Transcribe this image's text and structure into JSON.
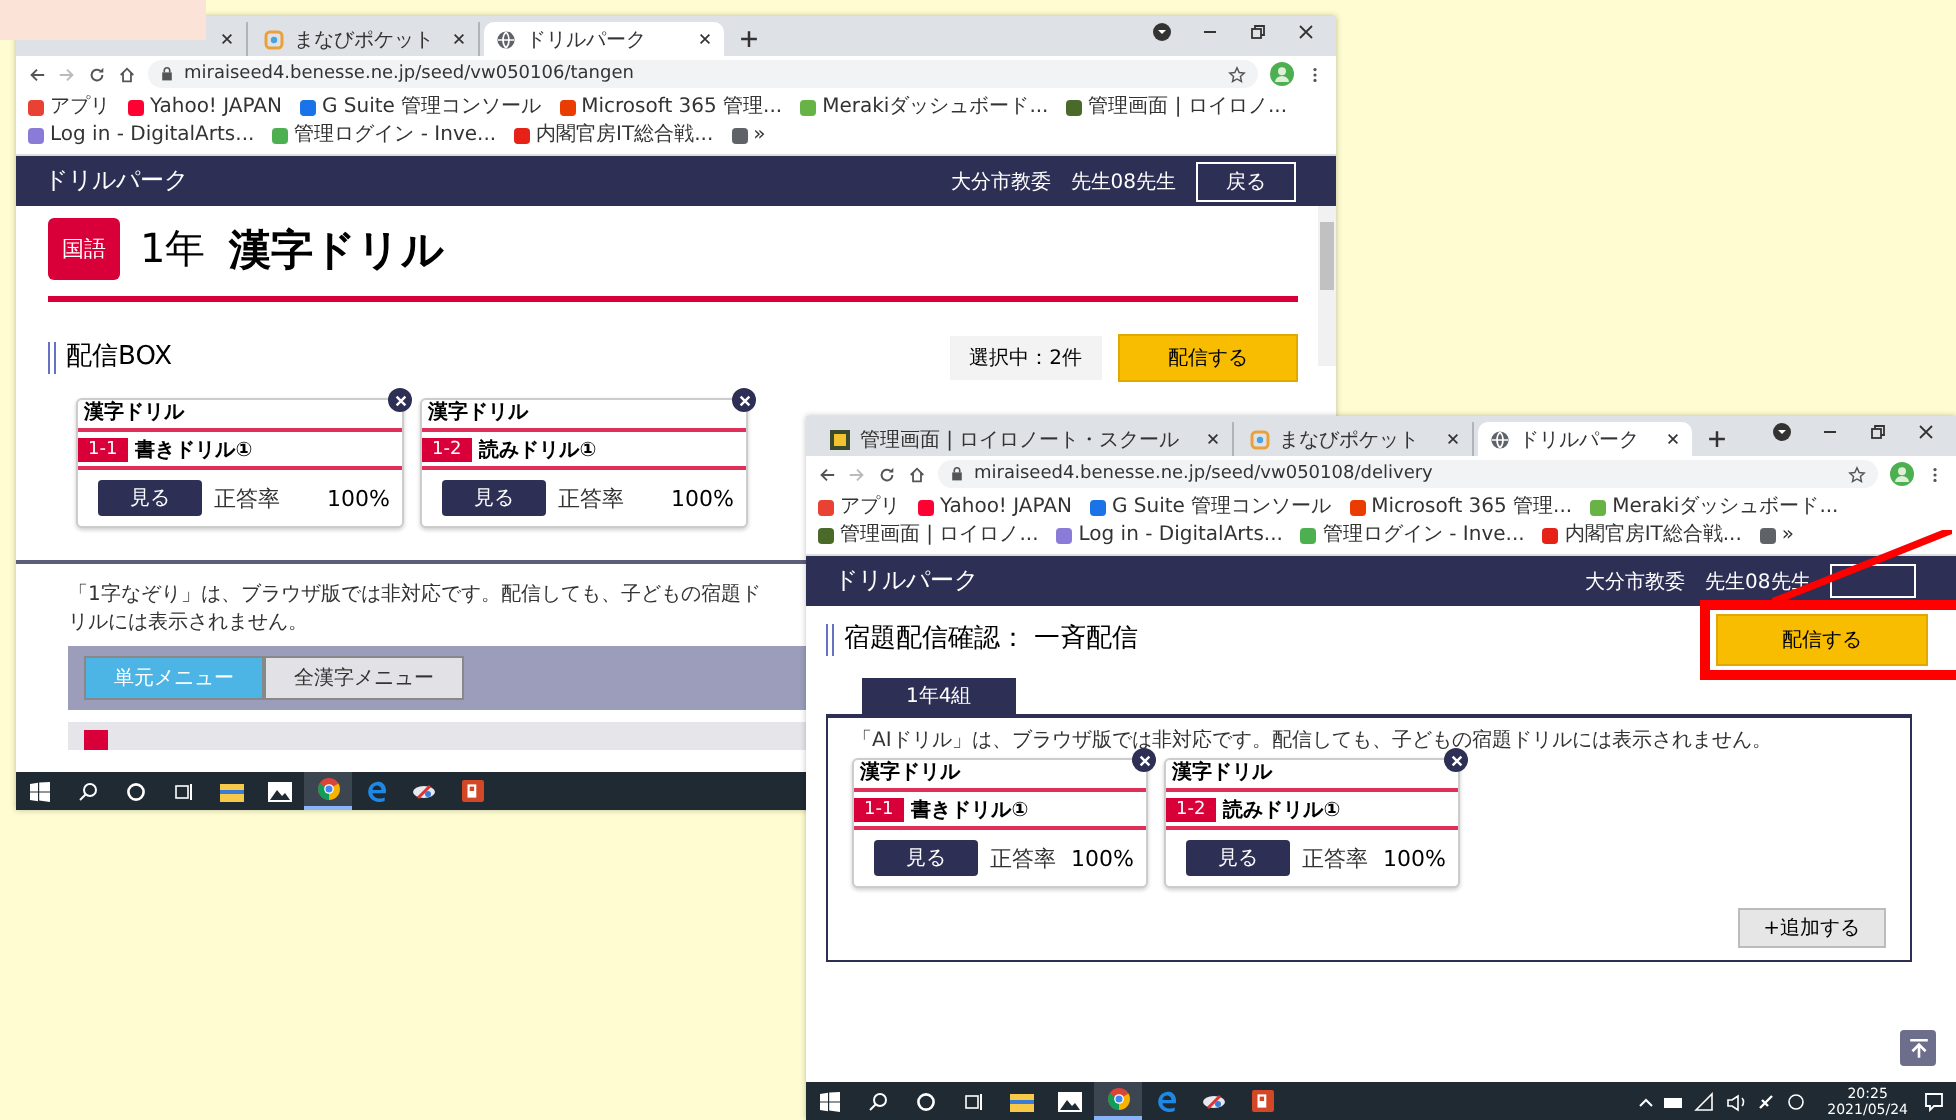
{
  "windows": [
    {
      "kind": "unit",
      "tabs": [
        {
          "selected": false
        },
        {
          "kind": "manabi",
          "title": "まなびポケット",
          "selected": false
        },
        {
          "kind": "globe",
          "title": "ドリルパーク",
          "selected": true
        }
      ],
      "url": "miraiseed4.benesse.ne.jp/seed/vw050106/tangen",
      "bookmarks": [
        {
          "title": "アプリ",
          "color": "#e94235"
        },
        {
          "title": "Yahoo! JAPAN",
          "color": "#ff0033"
        },
        {
          "title": "G Suite 管理コンソール",
          "color": "#1a73e8"
        },
        {
          "title": "Microsoft 365 管理...",
          "color": "#eb3c00"
        },
        {
          "title": "Merakiダッシュボード...",
          "color": "#67b346"
        },
        {
          "title": "管理画面 | ロイロノ...",
          "color": "#4a6a2a"
        },
        {
          "title": "Log in - DigitalArts...",
          "color": "#8a7bd8"
        },
        {
          "title": "管理ログイン - Inve...",
          "color": "#4caf50"
        },
        {
          "title": "内閣官房IT総合戦...",
          "color": "#e62117"
        },
        {
          "title": "»",
          "color": "#5f6368"
        }
      ],
      "header": {
        "brand": "ドリルパーク",
        "org": "大分市教委",
        "user": "先生08先生",
        "back": "戻る"
      },
      "page": {
        "subject": "国語",
        "grade": "1年",
        "title": "漢字ドリル",
        "section": "配信BOX",
        "selection": "選択中：2件",
        "deliver": "配信する",
        "cards": [
          {
            "category": "漢字ドリル",
            "number": "1-1",
            "name": "書きドリル①",
            "view": "見る",
            "rate_label": "正答率",
            "rate": "100%"
          },
          {
            "category": "漢字ドリル",
            "number": "1-2",
            "name": "読みドリル①",
            "view": "見る",
            "rate_label": "正答率",
            "rate": "100%"
          }
        ],
        "notice": "「1字なぞり」は、ブラウザ版では非対応です。配信しても、子どもの宿題ドリルには表示されません。",
        "menu": [
          {
            "label": "単元メニュー",
            "selected": true
          },
          {
            "label": "全漢字メニュー",
            "selected": false
          }
        ]
      },
      "taskbar": {
        "apps": [
          {
            "kind": "start",
            "active": false
          },
          {
            "kind": "search",
            "active": false
          },
          {
            "kind": "cortana",
            "active": false
          },
          {
            "kind": "taskview",
            "active": false
          },
          {
            "kind": "explorer",
            "active": false
          },
          {
            "kind": "photos",
            "active": false
          },
          {
            "kind": "chrome",
            "active": true
          },
          {
            "kind": "edge",
            "active": false
          },
          {
            "kind": "app",
            "active": false
          },
          {
            "kind": "powerpoint",
            "active": false
          }
        ]
      }
    },
    {
      "kind": "delivery",
      "tabs": [
        {
          "kind": "roilo",
          "title": "管理画面 | ロイロノート・スクール",
          "selected": false
        },
        {
          "kind": "manabi",
          "title": "まなびポケット",
          "selected": false
        },
        {
          "kind": "globe",
          "title": "ドリルパーク",
          "selected": true
        }
      ],
      "url": "miraiseed4.benesse.ne.jp/seed/vw050108/delivery",
      "bookmarks": [
        {
          "title": "アプリ",
          "color": "#e94235"
        },
        {
          "title": "Yahoo! JAPAN",
          "color": "#ff0033"
        },
        {
          "title": "G Suite 管理コンソール",
          "color": "#1a73e8"
        },
        {
          "title": "Microsoft 365 管理...",
          "color": "#eb3c00"
        },
        {
          "title": "Merakiダッシュボード...",
          "color": "#67b346"
        },
        {
          "title": "管理画面 | ロイロノ...",
          "color": "#4a6a2a"
        },
        {
          "title": "Log in - DigitalArts...",
          "color": "#8a7bd8"
        },
        {
          "title": "管理ログイン - Inve...",
          "color": "#4caf50"
        },
        {
          "title": "内閣官房IT総合戦...",
          "color": "#e62117"
        },
        {
          "title": "»",
          "color": "#5f6368"
        }
      ],
      "header": {
        "brand": "ドリルパーク",
        "org": "大分市教委",
        "user": "先生08先生"
      },
      "page": {
        "section": "宿題配信確認： 一斉配信",
        "deliver": "配信する",
        "class_tab": "1年4組",
        "notice": "「AIドリル」は、ブラウザ版では非対応です。配信しても、子どもの宿題ドリルには表示されません。",
        "cards": [
          {
            "category": "漢字ドリル",
            "number": "1-1",
            "name": "書きドリル①",
            "view": "見る",
            "rate_label": "正答率",
            "rate": "100%"
          },
          {
            "category": "漢字ドリル",
            "number": "1-2",
            "name": "読みドリル①",
            "view": "見る",
            "rate_label": "正答率",
            "rate": "100%"
          }
        ],
        "add": "+追加する"
      },
      "taskbar": {
        "apps": [
          {
            "kind": "start",
            "active": false
          },
          {
            "kind": "search",
            "active": false
          },
          {
            "kind": "cortana",
            "active": false
          },
          {
            "kind": "taskview",
            "active": false
          },
          {
            "kind": "explorer",
            "active": false
          },
          {
            "kind": "photos",
            "active": false
          },
          {
            "kind": "chrome",
            "active": true
          },
          {
            "kind": "edge",
            "active": false
          },
          {
            "kind": "app",
            "active": false
          },
          {
            "kind": "powerpoint",
            "active": false
          }
        ],
        "tray": {
          "time": "20:25",
          "date": "2021/05/24"
        }
      }
    }
  ]
}
